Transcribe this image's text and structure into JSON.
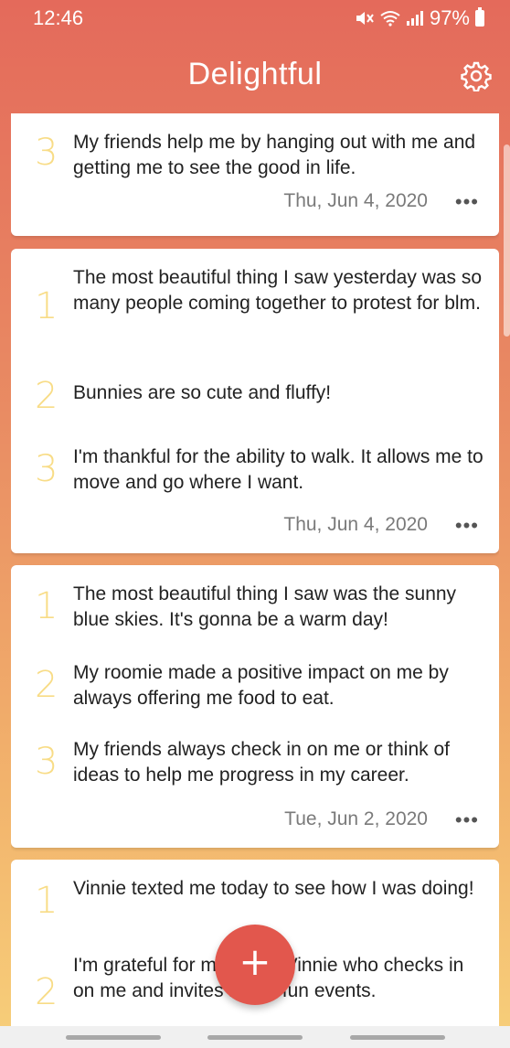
{
  "status": {
    "time": "12:46",
    "battery": "97%"
  },
  "header": {
    "title": "Delightful"
  },
  "colors": {
    "accent": "#e2574d",
    "number": "#f8dc86",
    "gradient_top": "#e46a5b",
    "gradient_bottom": "#f7cf7a"
  },
  "cards": [
    {
      "entries": [
        {
          "num": "3",
          "text": "My friends help me by hanging out with me and getting me to see the good in life."
        }
      ],
      "date": "Thu, Jun 4, 2020"
    },
    {
      "entries": [
        {
          "num": "1",
          "text": "The most beautiful thing I saw yesterday was so many people coming together to protest for blm."
        },
        {
          "num": "2",
          "text": "Bunnies are so cute and fluffy!"
        },
        {
          "num": "3",
          "text": "I'm thankful for the ability to walk. It allows me to move and go where I want."
        }
      ],
      "date": "Thu, Jun 4, 2020"
    },
    {
      "entries": [
        {
          "num": "1",
          "text": "The most beautiful thing I saw was the sunny blue skies. It's gonna be a warm day!"
        },
        {
          "num": "2",
          "text": "My roomie made a positive impact on me by always offering me food to eat."
        },
        {
          "num": "3",
          "text": "My friends always check in on me or think of ideas to help me progress in my career."
        }
      ],
      "date": "Tue, Jun 2, 2020"
    },
    {
      "entries": [
        {
          "num": "1",
          "text": "Vinnie texted me today to see how I was doing!"
        },
        {
          "num": "2",
          "text": "I'm grateful for my friend Vinnie who checks in on me and invites me to fun events."
        }
      ],
      "date": ""
    }
  ],
  "more_label": "•••",
  "fab": {
    "label": "+"
  },
  "icons": {
    "settings": "gear-icon",
    "add": "plus-icon"
  }
}
